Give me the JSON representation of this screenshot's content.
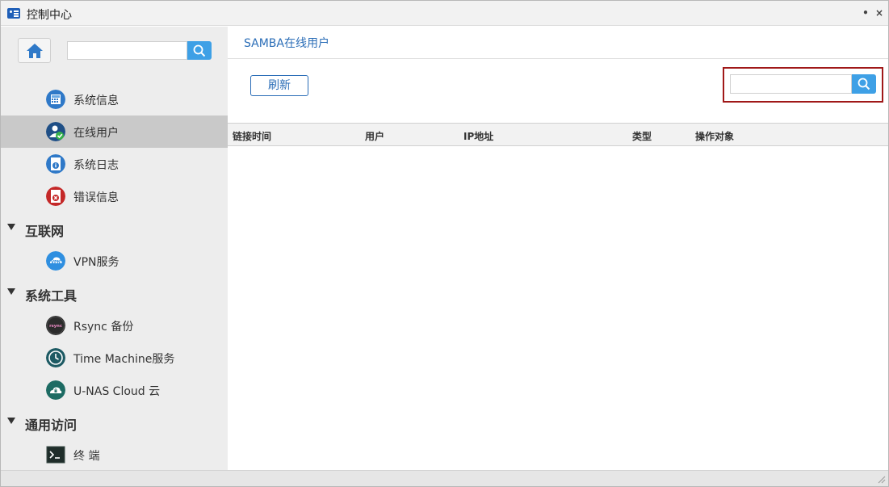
{
  "window": {
    "title": "控制中心",
    "minimize_glyph": "•",
    "close_glyph": "×"
  },
  "sidebar": {
    "home_icon": "home-icon",
    "search": {
      "placeholder": "",
      "value": ""
    },
    "items": [
      {
        "label": "系统信息",
        "icon": "system-info-icon",
        "active": false
      },
      {
        "label": "在线用户",
        "icon": "online-users-icon",
        "active": true
      },
      {
        "label": "系统日志",
        "icon": "system-log-icon",
        "active": false
      },
      {
        "label": "错误信息",
        "icon": "error-info-icon",
        "active": false
      }
    ],
    "groups": [
      {
        "label": "互联网",
        "items": [
          {
            "label": "VPN服务",
            "icon": "vpn-icon"
          }
        ]
      },
      {
        "label": "系统工具",
        "items": [
          {
            "label": "Rsync 备份",
            "icon": "rsync-icon",
            "badge": "rsync"
          },
          {
            "label": "Time Machine服务",
            "icon": "time-machine-icon"
          },
          {
            "label": "U-NAS Cloud 云",
            "icon": "cloud-icon"
          }
        ]
      },
      {
        "label": "通用访问",
        "items": [
          {
            "label": "终 端",
            "icon": "terminal-icon"
          }
        ]
      }
    ]
  },
  "main": {
    "title": "SAMBA在线用户",
    "refresh_label": "刷新",
    "search": {
      "placeholder": "",
      "value": ""
    },
    "table": {
      "columns": [
        "链接时间",
        "用户",
        "IP地址",
        "类型",
        "操作对象"
      ],
      "rows": []
    }
  },
  "colors": {
    "accent": "#2a6db7",
    "search_button": "#3ea0e6",
    "highlight_border": "#a01818",
    "active_item": "#c9c9c9"
  }
}
